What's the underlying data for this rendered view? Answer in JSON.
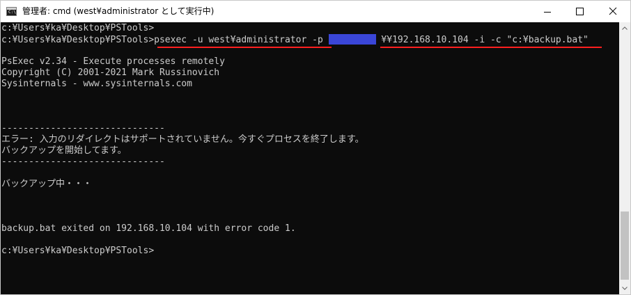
{
  "window": {
    "title": "管理者: cmd (west¥administrator として実行中)",
    "icon_label": "C:\\"
  },
  "console": {
    "lines": [
      "c:¥Users¥ka¥Desktop¥PSTools>",
      "c:¥Users¥ka¥Desktop¥PSTools>",
      "",
      "PsExec v2.34 - Execute processes remotely",
      "Copyright (C) 2001-2021 Mark Russinovich",
      "Sysinternals - www.sysinternals.com",
      "",
      "",
      "",
      "------------------------------",
      "エラー: 入力のリダイレクトはサポートされていません。今すぐプロセスを終了します。",
      "バックアップを開始してます。",
      "------------------------------",
      "",
      "バックアップ中・・・",
      "",
      "",
      "",
      "backup.bat exited on 192.168.10.104 with error code 1.",
      "",
      "c:¥Users¥ka¥Desktop¥PSTools>"
    ],
    "command_part1": "psexec -u west¥administrator -p ",
    "command_part2": " ¥¥192.168.10.104 -i -c \"c:¥backup.bat\""
  },
  "colors": {
    "console_bg": "#0c0c0c",
    "console_text": "#cccccc",
    "redaction": "#3a46d8",
    "underline": "#ff1f1f"
  }
}
